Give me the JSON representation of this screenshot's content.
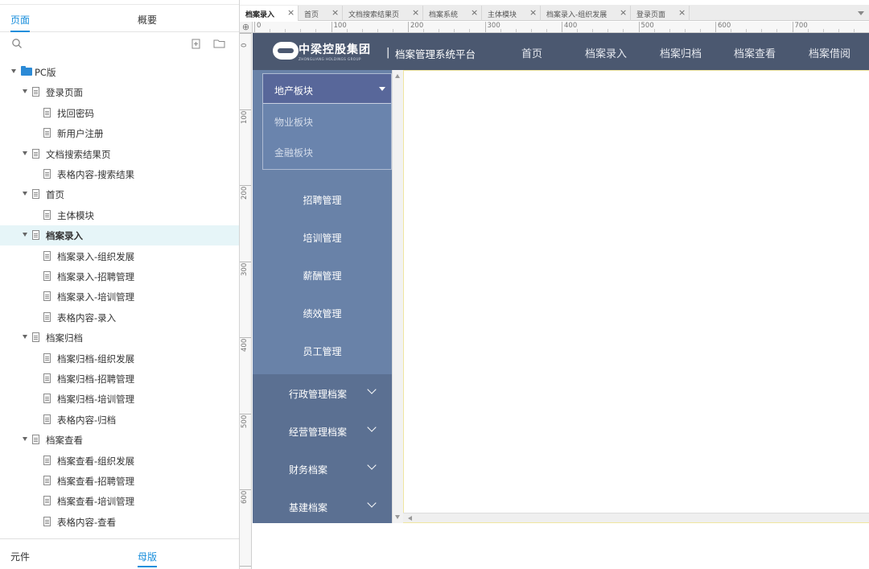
{
  "left_panel": {
    "tabs": {
      "pages": "页面",
      "overview": "概要"
    },
    "tree": [
      {
        "label": "PC版",
        "type": "folder",
        "level": 0,
        "expanded": true
      },
      {
        "label": "登录页面",
        "type": "page",
        "level": 1,
        "expanded": true
      },
      {
        "label": "找回密码",
        "type": "page",
        "level": 2
      },
      {
        "label": "新用户注册",
        "type": "page",
        "level": 2
      },
      {
        "label": "文档搜索结果页",
        "type": "page",
        "level": 1,
        "expanded": true
      },
      {
        "label": "表格内容-搜索结果",
        "type": "page",
        "level": 2
      },
      {
        "label": "首页",
        "type": "page",
        "level": 1,
        "expanded": true
      },
      {
        "label": "主体模块",
        "type": "page",
        "level": 2
      },
      {
        "label": "档案录入",
        "type": "page",
        "level": 1,
        "expanded": true,
        "selected": true
      },
      {
        "label": "档案录入-组织发展",
        "type": "page",
        "level": 2
      },
      {
        "label": "档案录入-招聘管理",
        "type": "page",
        "level": 2
      },
      {
        "label": "档案录入-培训管理",
        "type": "page",
        "level": 2
      },
      {
        "label": "表格内容-录入",
        "type": "page",
        "level": 2
      },
      {
        "label": "档案归档",
        "type": "page",
        "level": 1,
        "expanded": true
      },
      {
        "label": "档案归档-组织发展",
        "type": "page",
        "level": 2
      },
      {
        "label": "档案归档-招聘管理",
        "type": "page",
        "level": 2
      },
      {
        "label": "档案归档-培训管理",
        "type": "page",
        "level": 2
      },
      {
        "label": "表格内容-归档",
        "type": "page",
        "level": 2
      },
      {
        "label": "档案查看",
        "type": "page",
        "level": 1,
        "expanded": true
      },
      {
        "label": "档案查看-组织发展",
        "type": "page",
        "level": 2
      },
      {
        "label": "档案查看-招聘管理",
        "type": "page",
        "level": 2
      },
      {
        "label": "档案查看-培训管理",
        "type": "page",
        "level": 2
      },
      {
        "label": "表格内容-查看",
        "type": "page",
        "level": 2
      }
    ],
    "bottom_tabs": {
      "widgets": "元件",
      "masters": "母版"
    }
  },
  "doc_tabs": [
    {
      "label": "档案录入",
      "active": true
    },
    {
      "label": "首页"
    },
    {
      "label": "文档搜索结果页"
    },
    {
      "label": "档案系统"
    },
    {
      "label": "主体模块"
    },
    {
      "label": "档案录入-组织发展"
    },
    {
      "label": "登录页面"
    }
  ],
  "ruler": {
    "h_labels": [
      "0",
      "100",
      "200",
      "300",
      "400",
      "500",
      "600",
      "700"
    ],
    "v_labels": [
      "0",
      "100",
      "200",
      "300",
      "400",
      "500",
      "600"
    ]
  },
  "canvas": {
    "logo_text": "中梁控股集团",
    "logo_subtext": "ZHONGLIANG HOLDINGS GROUP",
    "separator": "|",
    "system_title": "档案管理系统平台",
    "nav": [
      "首页",
      "档案录入",
      "档案归档",
      "档案查看",
      "档案借阅"
    ],
    "dropdown": {
      "selected": "地产板块",
      "options": [
        "物业板块",
        "金融板块"
      ]
    },
    "sidebar_items": [
      "招聘管理",
      "培训管理",
      "薪酬管理",
      "绩效管理",
      "员工管理"
    ],
    "accordion": [
      "行政管理档案",
      "经营管理档案",
      "财务档案",
      "基建档案"
    ]
  },
  "colors": {
    "header_bg": "#4b5870",
    "sidebar_bg": "#6982a8",
    "accordion_bg": "#5b7092",
    "dropdown_head_bg": "#58679a",
    "accent_blue": "#1a8fdc"
  }
}
